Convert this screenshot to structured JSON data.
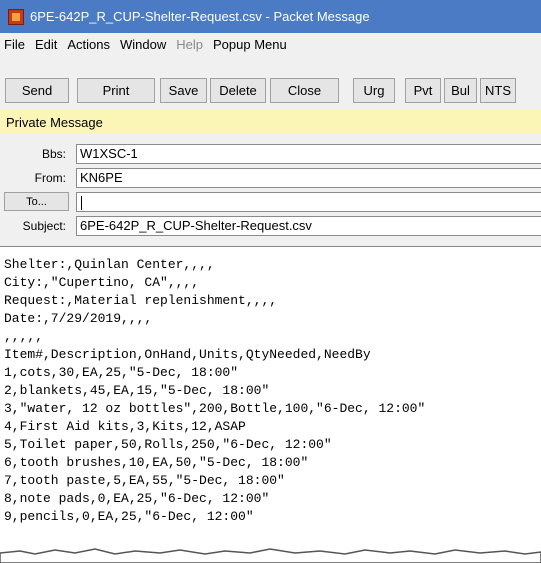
{
  "window": {
    "title": "6PE-642P_R_CUP-Shelter-Request.csv - Packet Message"
  },
  "menubar": {
    "items": [
      "File",
      "Edit",
      "Actions",
      "Window",
      "Help",
      "Popup Menu"
    ]
  },
  "toolbar": {
    "send": "Send",
    "print": "Print",
    "save": "Save",
    "delete": "Delete",
    "close": "Close",
    "urg": "Urg",
    "pvt": "Pvt",
    "bul": "Bul",
    "nts": "NTS"
  },
  "banner": {
    "text": "Private Message",
    "color": "#fbf6b6"
  },
  "header": {
    "bbs_label": "Bbs:",
    "bbs_value": "W1XSC-1",
    "from_label": "From:",
    "from_value": "KN6PE",
    "to_label": "To...",
    "to_value": "",
    "subject_label": "Subject:",
    "subject_value": "6PE-642P_R_CUP-Shelter-Request.csv"
  },
  "body": {
    "lines": [
      "Shelter:,Quinlan Center,,,,",
      "City:,\"Cupertino, CA\",,,,",
      "Request:,Material replenishment,,,,",
      "Date:,7/29/2019,,,,",
      ",,,,,",
      "Item#,Description,OnHand,Units,QtyNeeded,NeedBy",
      "1,cots,30,EA,25,\"5-Dec, 18:00\"",
      "2,blankets,45,EA,15,\"5-Dec, 18:00\"",
      "3,\"water, 12 oz bottles\",200,Bottle,100,\"6-Dec, 12:00\"",
      "4,First Aid kits,3,Kits,12,ASAP",
      "5,Toilet paper,50,Rolls,250,\"6-Dec, 12:00\"",
      "6,tooth brushes,10,EA,50,\"5-Dec, 18:00\"",
      "7,tooth paste,5,EA,55,\"5-Dec, 18:00\"",
      "8,note pads,0,EA,25,\"6-Dec, 12:00\"",
      "9,pencils,0,EA,25,\"6-Dec, 12:00\""
    ]
  }
}
